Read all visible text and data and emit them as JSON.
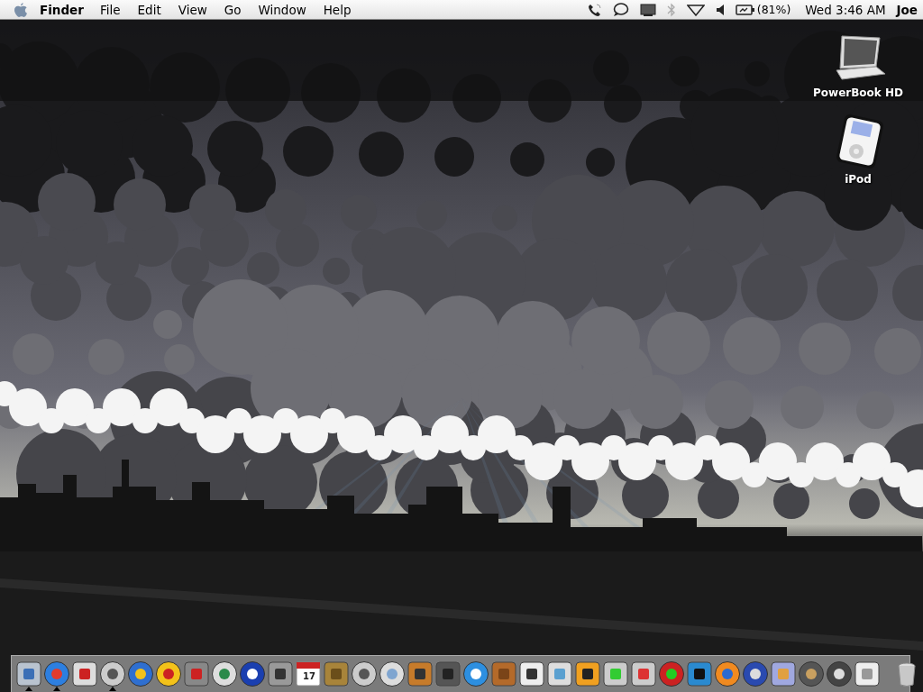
{
  "menu_bar": {
    "app_name": "Finder",
    "menus": [
      "File",
      "Edit",
      "View",
      "Go",
      "Window",
      "Help"
    ],
    "battery_reading": "(81%)",
    "clock": "Wed 3:46 AM",
    "user": "Joe"
  },
  "desktop_icons": [
    {
      "kind": "laptop",
      "label": "PowerBook HD"
    },
    {
      "kind": "ipod",
      "label": "iPod"
    }
  ],
  "dock": {
    "items": [
      {
        "running": true
      },
      {
        "running": true
      },
      {
        "running": false
      },
      {
        "running": true
      },
      {
        "running": false
      },
      {
        "running": false
      },
      {
        "running": false
      },
      {
        "running": false
      },
      {
        "running": false
      },
      {
        "running": false
      },
      {
        "running": false,
        "text": "17"
      },
      {
        "running": false
      },
      {
        "running": false
      },
      {
        "running": false
      },
      {
        "running": false
      },
      {
        "running": false
      },
      {
        "running": false
      },
      {
        "running": false
      },
      {
        "running": false
      },
      {
        "running": false
      },
      {
        "running": false
      },
      {
        "running": false
      },
      {
        "running": false
      },
      {
        "running": false
      },
      {
        "running": false
      },
      {
        "running": false
      },
      {
        "running": false
      },
      {
        "running": false
      },
      {
        "running": false
      },
      {
        "running": false
      },
      {
        "running": false
      }
    ]
  }
}
